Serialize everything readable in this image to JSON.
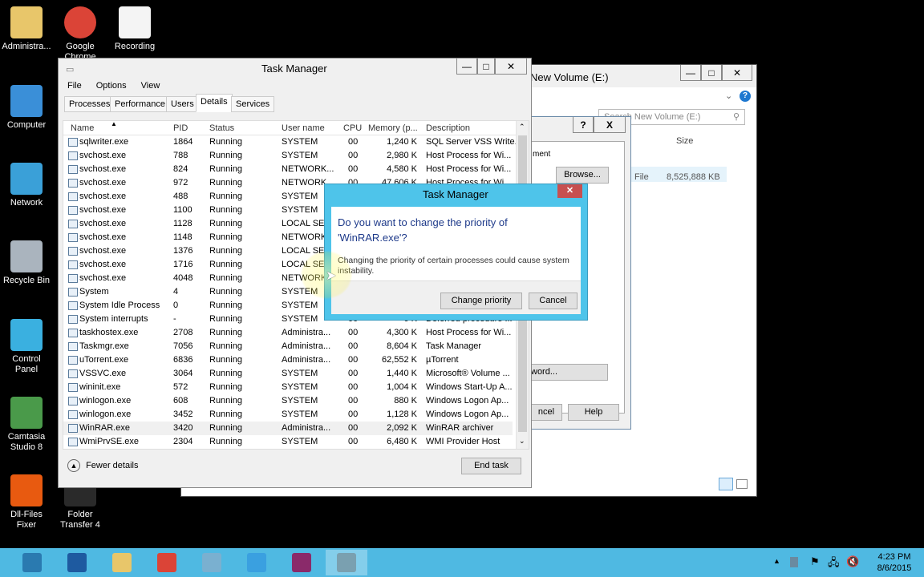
{
  "desktop_icons": [
    {
      "label": "Administra...",
      "icon": "user-folder-icon",
      "color": "#e8c66a"
    },
    {
      "label": "Google Chrome",
      "icon": "chrome-icon",
      "color": "#db4437"
    },
    {
      "label": "Recording",
      "icon": "document-icon",
      "color": "#f4f4f4"
    },
    {
      "label": "Computer",
      "icon": "computer-icon",
      "color": "#3a8fd8"
    },
    {
      "label": "Network",
      "icon": "network-globe-icon",
      "color": "#3aa0d8"
    },
    {
      "label": "Recycle Bin",
      "icon": "recycle-bin-icon",
      "color": "#aab4be"
    },
    {
      "label": "Control Panel",
      "icon": "control-panel-icon",
      "color": "#3ab0e0"
    },
    {
      "label": "Camtasia Studio 8",
      "icon": "camtasia-icon",
      "color": "#4a9a4a"
    },
    {
      "label": "Dll-Files Fixer",
      "icon": "dll-fixer-icon",
      "color": "#e85a10"
    },
    {
      "label": "Folder Transfer 4",
      "icon": "folder-transfer-icon",
      "color": "#2a2a2a"
    }
  ],
  "explorer": {
    "title": "New Volume (E:)",
    "search_placeholder": "Search New Volume (E:)",
    "col_size": "Size",
    "file_type": "File",
    "file_size": "8,525,888 KB"
  },
  "props_dialog": {
    "help": "?",
    "close": "X",
    "tab": "ment",
    "browse": "Browse...",
    "password": "word...",
    "cancel": "ncel",
    "help_btn": "Help"
  },
  "task_manager": {
    "title": "Task Manager",
    "menu": [
      "File",
      "Options",
      "View"
    ],
    "tabs": [
      "Processes",
      "Performance",
      "Users",
      "Details",
      "Services"
    ],
    "active_tab": "Details",
    "columns": [
      "Name",
      "PID",
      "Status",
      "User name",
      "CPU",
      "Memory (p...",
      "Description"
    ],
    "rows": [
      [
        "sqlwriter.exe",
        "1864",
        "Running",
        "SYSTEM",
        "00",
        "1,240 K",
        "SQL Server VSS Write..."
      ],
      [
        "svchost.exe",
        "788",
        "Running",
        "SYSTEM",
        "00",
        "2,980 K",
        "Host Process for Wi..."
      ],
      [
        "svchost.exe",
        "824",
        "Running",
        "NETWORK...",
        "00",
        "4,580 K",
        "Host Process for Wi..."
      ],
      [
        "svchost.exe",
        "972",
        "Running",
        "NETWORK...",
        "00",
        "47,606 K",
        "Host Process for Wi..."
      ],
      [
        "svchost.exe",
        "488",
        "Running",
        "SYSTEM",
        "",
        "",
        ""
      ],
      [
        "svchost.exe",
        "1100",
        "Running",
        "SYSTEM",
        "",
        "",
        ""
      ],
      [
        "svchost.exe",
        "1128",
        "Running",
        "LOCAL SE...",
        "",
        "",
        ""
      ],
      [
        "svchost.exe",
        "1148",
        "Running",
        "NETWORK...",
        "",
        "",
        ""
      ],
      [
        "svchost.exe",
        "1376",
        "Running",
        "LOCAL SE...",
        "",
        "",
        ""
      ],
      [
        "svchost.exe",
        "1716",
        "Running",
        "LOCAL SE...",
        "",
        "",
        ""
      ],
      [
        "svchost.exe",
        "4048",
        "Running",
        "NETWORK...",
        "",
        "",
        ""
      ],
      [
        "System",
        "4",
        "Running",
        "SYSTEM",
        "",
        "",
        ""
      ],
      [
        "System Idle Process",
        "0",
        "Running",
        "SYSTEM",
        "",
        "",
        ""
      ],
      [
        "System interrupts",
        "-",
        "Running",
        "SYSTEM",
        "00",
        "0 K",
        "Deferred procedure ..."
      ],
      [
        "taskhostex.exe",
        "2708",
        "Running",
        "Administra...",
        "00",
        "4,300 K",
        "Host Process for Wi..."
      ],
      [
        "Taskmgr.exe",
        "7056",
        "Running",
        "Administra...",
        "00",
        "8,604 K",
        "Task Manager"
      ],
      [
        "uTorrent.exe",
        "6836",
        "Running",
        "Administra...",
        "00",
        "62,552 K",
        "µTorrent"
      ],
      [
        "VSSVC.exe",
        "3064",
        "Running",
        "SYSTEM",
        "00",
        "1,440 K",
        "Microsoft® Volume ..."
      ],
      [
        "wininit.exe",
        "572",
        "Running",
        "SYSTEM",
        "00",
        "1,004 K",
        "Windows Start-Up A..."
      ],
      [
        "winlogon.exe",
        "608",
        "Running",
        "SYSTEM",
        "00",
        "880 K",
        "Windows Logon Ap..."
      ],
      [
        "winlogon.exe",
        "3452",
        "Running",
        "SYSTEM",
        "00",
        "1,128 K",
        "Windows Logon Ap..."
      ],
      [
        "WinRAR.exe",
        "3420",
        "Running",
        "Administra...",
        "00",
        "2,092 K",
        "WinRAR archiver"
      ],
      [
        "WmiPrvSE.exe",
        "2304",
        "Running",
        "SYSTEM",
        "00",
        "6,480 K",
        "WMI Provider Host"
      ]
    ],
    "selected_row": 21,
    "fewer_details": "Fewer details",
    "end_task": "End task"
  },
  "confirm_dialog": {
    "title": "Task Manager",
    "question": "Do you want to change the priority of 'WinRAR.exe'?",
    "message": "Changing the priority of certain processes could cause system instability.",
    "confirm": "Change priority",
    "cancel": "Cancel"
  },
  "taskbar": {
    "time": "4:23 PM",
    "date": "8/6/2015",
    "color": "#4fb9e2"
  },
  "colors": {
    "dialog_border": "#4ec4ea",
    "heading": "#1e3a8a",
    "close_red": "#c75050"
  }
}
